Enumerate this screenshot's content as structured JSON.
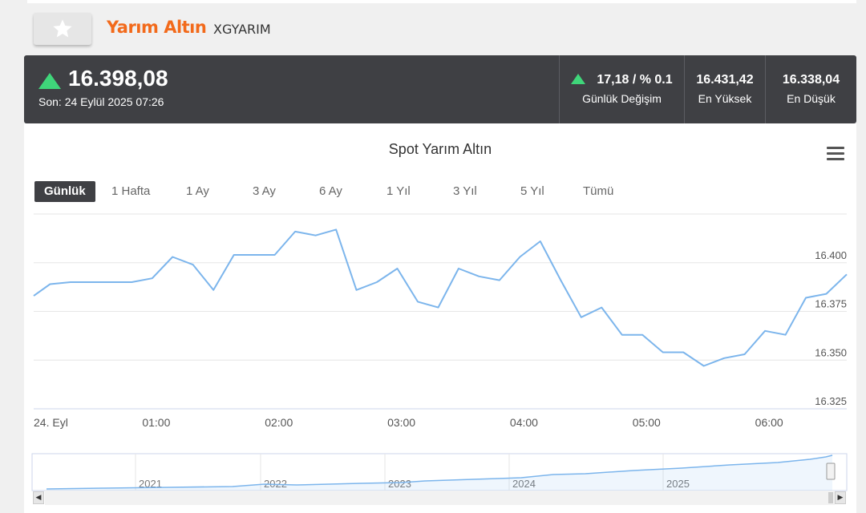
{
  "header": {
    "title": "Yarım Altın",
    "code": "XGYARIM",
    "favorite_icon": "star-icon"
  },
  "quote": {
    "price": "16.398,08",
    "last_update": "Son: 24 Eylül 2025 07:26",
    "direction": "up",
    "change": "17,18 / % 0.1",
    "change_label": "Günlük Değişim",
    "high": "16.431,42",
    "high_label": "En Yüksek",
    "low": "16.338,04",
    "low_label": "En Düşük",
    "colors": {
      "up": "#3fd67a",
      "bar_bg": "#3f4044",
      "title": "#f26a1b",
      "line": "#7cb5ec"
    }
  },
  "chart": {
    "title": "Spot Yarım Altın",
    "menu_icon": "hamburger-menu-icon",
    "ranges": [
      "Günlük",
      "1 Hafta",
      "1 Ay",
      "3 Ay",
      "6 Ay",
      "1 Yıl",
      "3 Yıl",
      "5 Yıl",
      "Tümü"
    ],
    "active_range": "Günlük"
  },
  "navigator": {
    "labels": [
      "2021",
      "2022",
      "2023",
      "2024",
      "2025"
    ],
    "left_arrow": "◀",
    "right_arrow": "▶"
  },
  "chart_data": {
    "type": "line",
    "title": "Spot Yarım Altın",
    "xlabel": "",
    "ylabel": "",
    "x_tick_labels": [
      "24. Eyl",
      "01:00",
      "02:00",
      "03:00",
      "04:00",
      "05:00",
      "06:00"
    ],
    "y_tick_labels": [
      "16.325",
      "16.350",
      "16.375",
      "16.400"
    ],
    "ylim": [
      16.325,
      16.425
    ],
    "xlim_minutes": [
      0,
      398
    ],
    "grid": true,
    "series": [
      {
        "x_minutes": [
          0,
          8,
          18,
          28,
          38,
          48,
          58,
          68,
          78,
          88,
          98,
          108,
          118,
          128,
          138,
          148,
          158,
          168,
          178,
          188,
          198,
          208,
          218,
          228,
          238,
          248,
          258,
          268,
          278,
          288,
          298,
          308,
          318,
          328,
          338,
          348,
          358,
          368,
          378,
          388,
          398
        ],
        "values": [
          16.383,
          16.389,
          16.39,
          16.39,
          16.39,
          16.39,
          16.392,
          16.403,
          16.399,
          16.386,
          16.404,
          16.404,
          16.404,
          16.416,
          16.414,
          16.417,
          16.386,
          16.39,
          16.397,
          16.38,
          16.377,
          16.397,
          16.393,
          16.391,
          16.403,
          16.411,
          16.391,
          16.372,
          16.377,
          16.363,
          16.363,
          16.354,
          16.354,
          16.347,
          16.351,
          16.353,
          16.365,
          16.363,
          16.382,
          16.384,
          16.394
        ]
      }
    ]
  }
}
